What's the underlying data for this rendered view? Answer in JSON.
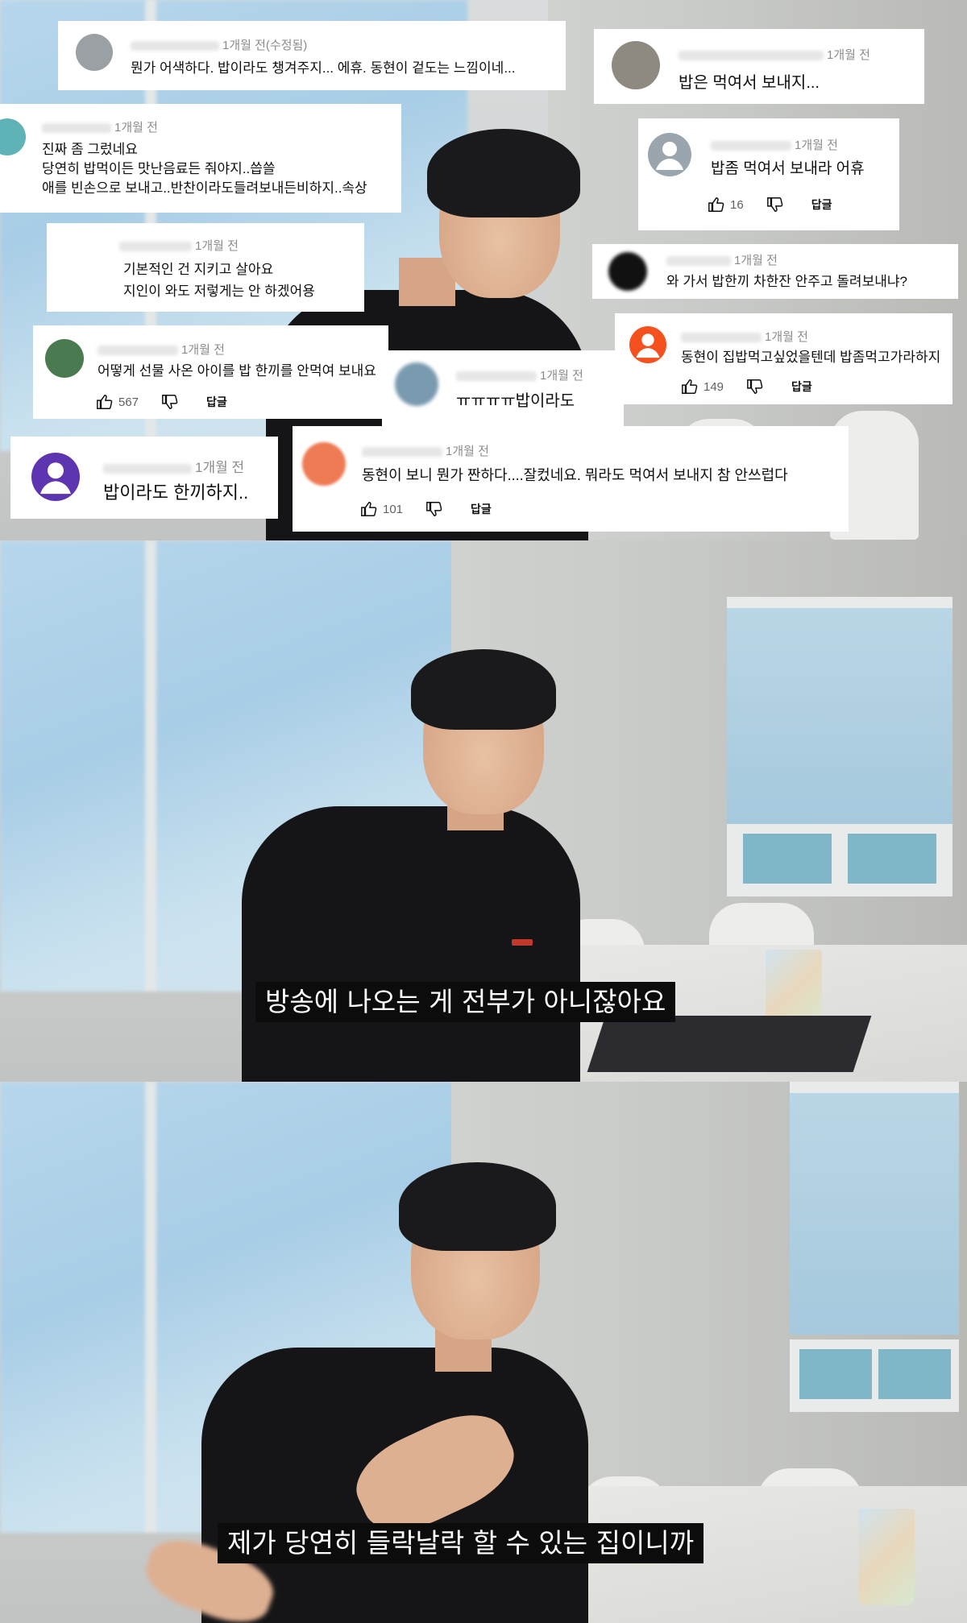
{
  "comments": [
    {
      "time": "1개월 전(수정됨)",
      "text": "뭔가 어색하다. 밥이라도 챙겨주지...  에휴. 동현이 겉도는 느낌이네...",
      "avatar_color": "#9aa0a3"
    },
    {
      "time": "1개월 전",
      "text": "밥은 먹여서 보내지...",
      "avatar_color": "#8f8a80"
    },
    {
      "time": "1개월 전",
      "lines": [
        "진짜 좀 그렀네요",
        "당연히 밥먹이든 맛난음료든 줘야지..씁쓸",
        "애를 빈손으로 보내고..반찬이라도들려보내든비하지..속상"
      ],
      "avatar_color": "#5fb3b7"
    },
    {
      "time": "1개월 전",
      "text": "밥좀 먹여서 보내라  어휴",
      "likes": "16",
      "reply": "답글",
      "avatar_color": "#9aa5ad"
    },
    {
      "time": "1개월 전",
      "lines": [
        "기본적인 건 지키고 살아요",
        "지인이 와도 저렇게는 안 하겠어용"
      ],
      "avatar_color": "#ffffff"
    },
    {
      "time": "1개월 전",
      "text": "와 가서 밥한끼 차한잔 안주고 돌려보내냐?",
      "avatar_color": "#111111"
    },
    {
      "time": "1개월 전",
      "text": "어떻게 선물 사온 아이를 밥 한끼를 안먹여 보내요",
      "likes": "567",
      "reply": "답글",
      "avatar_color": "#4a7a4f"
    },
    {
      "time": "1개월 전",
      "text": "동현이 집밥먹고싶었을텐데 밥좀먹고가라하지",
      "likes": "149",
      "reply": "답글",
      "avatar_color": "#f4511e"
    },
    {
      "time": "1개월 전",
      "text": "ㅠㅠㅠㅠ밥이라도",
      "avatar_color": "#7a9ab0"
    },
    {
      "time": "1개월 전",
      "text": "밥이라도 한끼하지..",
      "avatar_color": "#5e35b1"
    },
    {
      "time": "1개월 전",
      "text": "동현이 보니 뭔가 짠하다....잘컸네요.  뭐라도 먹여서 보내지 참 안쓰럽다",
      "likes": "101",
      "reply": "답글",
      "avatar_color": "#ef7b55"
    }
  ],
  "subtitles": {
    "panel2": "방송에 나오는 게 전부가 아니잖아요",
    "panel3": "제가 당연히 들락날락 할 수 있는 집이니까"
  },
  "icons": {
    "like": "thumbs-up-icon",
    "dislike": "thumbs-down-icon",
    "avatar": "user-avatar-icon"
  }
}
